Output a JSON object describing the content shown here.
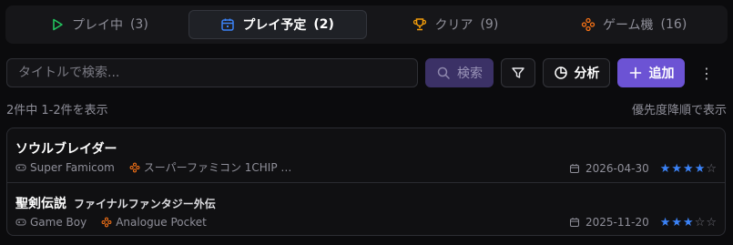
{
  "tabs": [
    {
      "label": "プレイ中",
      "count": "(3)",
      "icon": "play-icon",
      "color": "#22c55e"
    },
    {
      "label": "プレイ予定",
      "count": "(2)",
      "icon": "calendar-icon",
      "color": "#3b82f6"
    },
    {
      "label": "クリア",
      "count": "(9)",
      "icon": "trophy-icon",
      "color": "#f59e0b"
    },
    {
      "label": "ゲーム機",
      "count": "(16)",
      "icon": "gamepad-icon",
      "color": "#f97316"
    }
  ],
  "active_tab": 1,
  "toolbar": {
    "search_placeholder": "タイトルで検索...",
    "search_value": "",
    "search_label": "検索",
    "analysis_label": "分析",
    "add_label": "追加",
    "more_label": "⋮"
  },
  "summary": {
    "count_text": "2件中 1-2件を表示",
    "sort_text": "優先度降順で表示"
  },
  "games": [
    {
      "title": "ソウルブレイダー",
      "subtitle": "",
      "platform": "Super Famicom",
      "device": "スーパーファミコン 1CHIP …",
      "date": "2026-04-30",
      "rating": 4,
      "rating_max": 5
    },
    {
      "title": "聖剣伝説",
      "subtitle": "ファイナルファンタジー外伝",
      "platform": "Game Boy",
      "device": "Analogue Pocket",
      "date": "2025-11-20",
      "rating": 3,
      "rating_max": 5
    }
  ],
  "colors": {
    "accent": "#6c53d4",
    "star_on": "#3b82f6",
    "star_off": "#70707a",
    "device_icon": "#f97316"
  }
}
